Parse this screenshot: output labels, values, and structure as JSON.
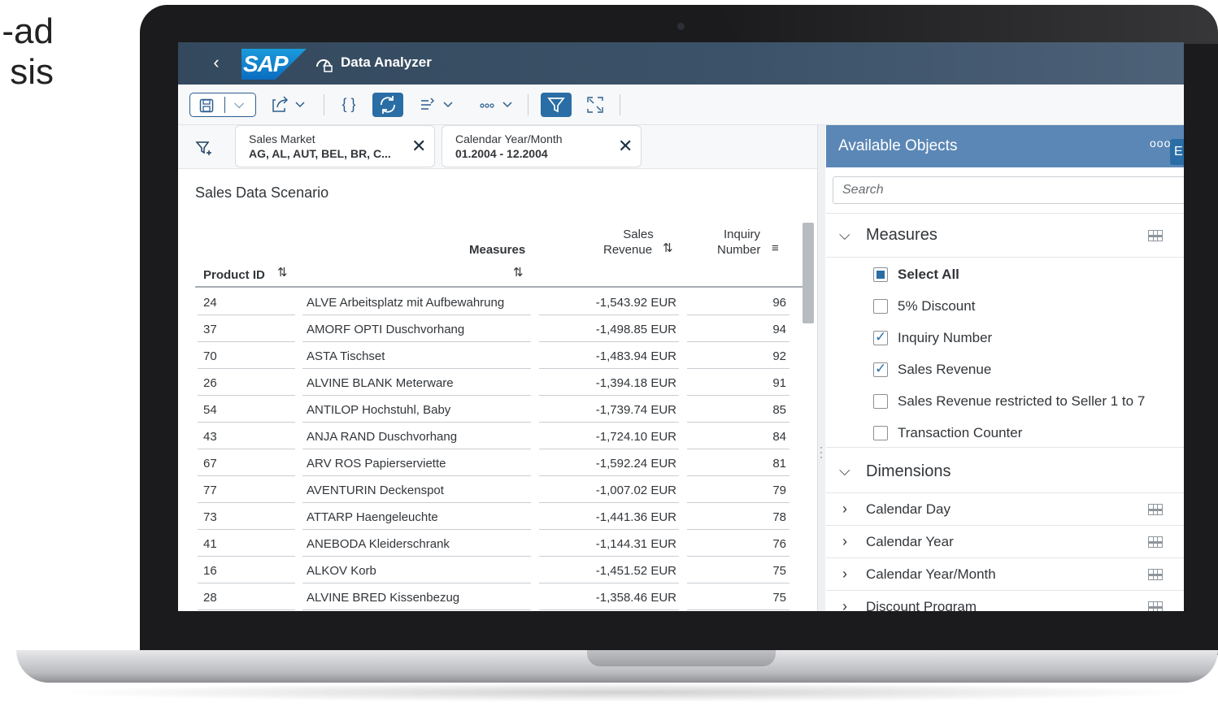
{
  "side_text": [
    "ad-",
    "sis"
  ],
  "shell": {
    "logo": "SAP",
    "title": "Data Analyzer"
  },
  "filters": [
    {
      "label": "Sales Market",
      "value": "AG, AL, AUT, BEL, BR, C..."
    },
    {
      "label": "Calendar Year/Month",
      "value": "01.2004 - 12.2004"
    }
  ],
  "report": {
    "title": "Sales Data Scenario",
    "headers": {
      "product_id": "Product ID",
      "measures": "Measures",
      "sales_revenue_1": "Sales",
      "sales_revenue_2": "Revenue",
      "inquiry_1": "Inquiry",
      "inquiry_2": "Number"
    },
    "rows": [
      {
        "id": "24",
        "name": "ALVE Arbeitsplatz mit Aufbewahrung",
        "revenue": "-1,543.92 EUR",
        "inquiry": "96"
      },
      {
        "id": "37",
        "name": "AMORF OPTI Duschvorhang",
        "revenue": "-1,498.85 EUR",
        "inquiry": "94"
      },
      {
        "id": "70",
        "name": "ASTA Tischset",
        "revenue": "-1,483.94 EUR",
        "inquiry": "92"
      },
      {
        "id": "26",
        "name": "ALVINE BLANK Meterware",
        "revenue": "-1,394.18 EUR",
        "inquiry": "91"
      },
      {
        "id": "54",
        "name": "ANTILOP Hochstuhl, Baby",
        "revenue": "-1,739.74 EUR",
        "inquiry": "85"
      },
      {
        "id": "43",
        "name": "ANJA RAND Duschvorhang",
        "revenue": "-1,724.10 EUR",
        "inquiry": "84"
      },
      {
        "id": "67",
        "name": "ARV ROS Papierserviette",
        "revenue": "-1,592.24 EUR",
        "inquiry": "81"
      },
      {
        "id": "77",
        "name": "AVENTURIN Deckenspot",
        "revenue": "-1,007.02 EUR",
        "inquiry": "79"
      },
      {
        "id": "73",
        "name": "ATTARP Haengeleuchte",
        "revenue": "-1,441.36 EUR",
        "inquiry": "78"
      },
      {
        "id": "41",
        "name": "ANEBODA Kleiderschrank",
        "revenue": "-1,144.31 EUR",
        "inquiry": "76"
      },
      {
        "id": "16",
        "name": "ALKOV Korb",
        "revenue": "-1,451.52 EUR",
        "inquiry": "75"
      },
      {
        "id": "28",
        "name": "ALVINE BRED Kissenbezug",
        "revenue": "-1,358.46 EUR",
        "inquiry": "75"
      }
    ]
  },
  "panel": {
    "title": "Available Objects",
    "more": "ooo",
    "search_placeholder": "Search",
    "measures_title": "Measures",
    "measures": [
      {
        "label": "Select All",
        "state": "partial"
      },
      {
        "label": "5% Discount",
        "state": "unchecked"
      },
      {
        "label": "Inquiry Number",
        "state": "checked"
      },
      {
        "label": "Sales Revenue",
        "state": "checked"
      },
      {
        "label": "Sales Revenue restricted to Seller 1 to 7",
        "state": "unchecked"
      },
      {
        "label": "Transaction Counter",
        "state": "unchecked"
      }
    ],
    "dimensions_title": "Dimensions",
    "dimensions": [
      "Calendar Day",
      "Calendar Year",
      "Calendar Year/Month",
      "Discount Program"
    ]
  },
  "colors": {
    "shell": "#34495e",
    "panel_header": "#5b87b6",
    "accent": "#2a6ea5"
  }
}
